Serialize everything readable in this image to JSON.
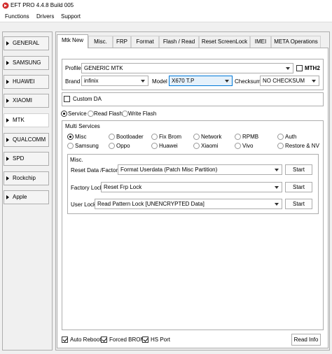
{
  "window": {
    "title": "EFT PRO 4.4.8 Build 005",
    "icon": "eft-logo-icon"
  },
  "menu": [
    "Functions",
    "Drivers",
    "Support"
  ],
  "sidebar": {
    "items": [
      {
        "label": "GENERAL"
      },
      {
        "label": "SAMSUNG"
      },
      {
        "label": "HUAWEI"
      },
      {
        "label": "XIAOMI"
      },
      {
        "label": "MTK"
      },
      {
        "label": "QUALCOMM"
      },
      {
        "label": "SPD"
      },
      {
        "label": "Rockchip"
      },
      {
        "label": "Apple"
      }
    ],
    "selected": "MTK"
  },
  "tabs": [
    "Mtk New",
    "Misc.",
    "FRP",
    "Format",
    "Flash / Read",
    "Reset ScreenLock",
    "IMEI",
    "META Operations"
  ],
  "active_tab": "Mtk New",
  "profile": {
    "label": "Profile",
    "value": "GENERIC MTK",
    "mth2_label": "MTH2",
    "mth2_checked": false,
    "brand_label": "Brand",
    "brand_value": "infinix",
    "model_label": "Model",
    "model_value": "X670 T.P",
    "checksum_label": "Checksum",
    "checksum_value": "NO CHECKSUM"
  },
  "custom_da": {
    "label": "Custom DA",
    "checked": false
  },
  "modes": [
    {
      "label": "Service",
      "selected": true
    },
    {
      "label": "Read Flash",
      "selected": false
    },
    {
      "label": "Write Flash",
      "selected": false
    }
  ],
  "multi_services": {
    "title": "Multi Services",
    "options": [
      "Misc",
      "Bootloader",
      "Fix Brom",
      "Network",
      "RPMB",
      "Auth",
      "Samsung",
      "Oppo",
      "Huawei",
      "Xiaomi",
      "Vivo",
      "Restore & NV"
    ],
    "selected": "Misc"
  },
  "misc": {
    "title": "Misc.",
    "rows": [
      {
        "label": "Reset Data /Factory",
        "value": "Format Userdata (Patch Misc Partition)",
        "button": "Start"
      },
      {
        "label": "Factory Lock",
        "value": "Reset Frp Lock",
        "button": "Start"
      },
      {
        "label": "User Lock",
        "value": "Read Pattern Lock [UNENCRYPTED Data]",
        "button": "Start"
      }
    ]
  },
  "footer": {
    "auto_reboot": {
      "label": "Auto Reboot",
      "checked": true
    },
    "forced_brom": {
      "label": "Forced BROM",
      "checked": true
    },
    "hs_port": {
      "label": "HS Port",
      "checked": true
    },
    "read_info_button": "Read Info"
  }
}
